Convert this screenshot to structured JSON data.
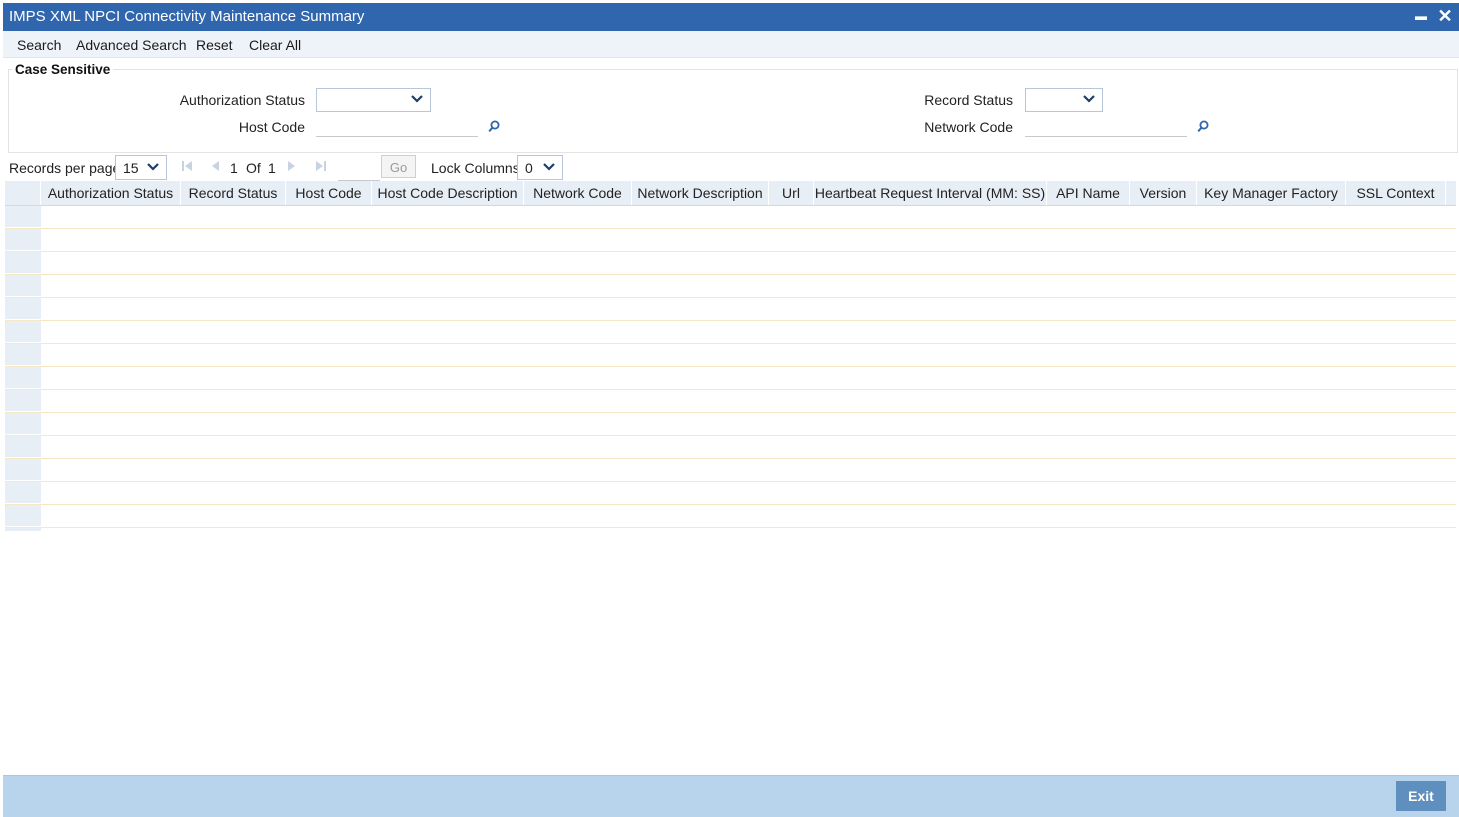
{
  "window": {
    "title": "IMPS XML NPCI Connectivity Maintenance Summary",
    "minimize_glyph": "▬",
    "close_glyph": "✕"
  },
  "menu": {
    "search": "Search",
    "advanced_search": "Advanced Search",
    "reset": "Reset",
    "clear_all": "Clear All"
  },
  "criteria": {
    "section_label": "Case Sensitive",
    "authorization_status_label": "Authorization Status",
    "authorization_status_value": "",
    "record_status_label": "Record Status",
    "record_status_value": "",
    "host_code_label": "Host Code",
    "host_code_value": "",
    "network_code_label": "Network Code",
    "network_code_value": ""
  },
  "pager": {
    "records_per_page_label": "Records per page",
    "records_per_page_value": "15",
    "current_page": "1",
    "of_label": "Of",
    "total_pages": "1",
    "go_label": "Go",
    "lock_columns_label": "Lock Columns",
    "lock_columns_value": "0"
  },
  "grid": {
    "columns": [
      "Authorization Status",
      "Record Status",
      "Host Code",
      "Host Code Description",
      "Network Code",
      "Network Description",
      "Url",
      "Heartbeat Request Interval (MM: SS)",
      "API Name",
      "Version",
      "Key Manager Factory",
      "SSL Context"
    ],
    "visible_empty_rows": 15
  },
  "footer": {
    "exit_label": "Exit"
  },
  "colors": {
    "titlebar": "#2f66ad",
    "footer": "#b8d4ec",
    "exit_button": "#5f8fbf",
    "grid_header": "#e8eef6"
  },
  "icons": {
    "lov": "search-icon",
    "dropdown": "chevron-down-icon",
    "first": "first-page-icon",
    "prev": "previous-page-icon",
    "next": "next-page-icon",
    "last": "last-page-icon"
  }
}
